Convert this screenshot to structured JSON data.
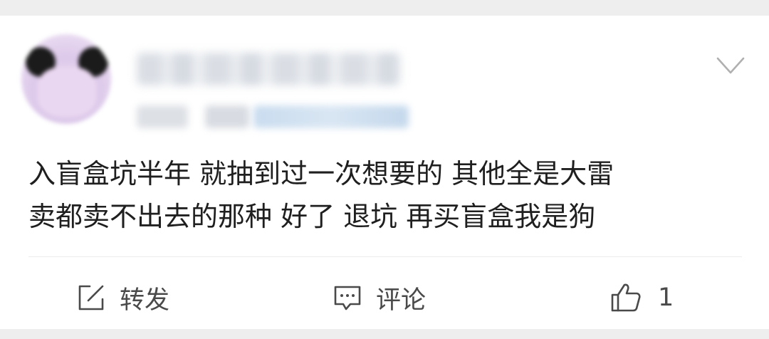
{
  "post": {
    "text": "入盲盒坑半年 就抽到过一次想要的 其他全是大雷\n卖都卖不出去的那种 好了 退坑 再买盲盒我是狗"
  },
  "actions": {
    "repost_label": "转发",
    "comment_label": "评论",
    "like_count": "1"
  },
  "icons": {
    "more": "chevron-down-icon",
    "repost": "edit-share-icon",
    "comment": "comment-bubble-icon",
    "like": "thumbs-up-icon"
  },
  "colors": {
    "page_background": "#eeeeee",
    "card_background": "#ffffff",
    "text": "#1f1f1f",
    "action_text": "#4a4a4a",
    "icon_stroke": "#b0b0b0"
  }
}
